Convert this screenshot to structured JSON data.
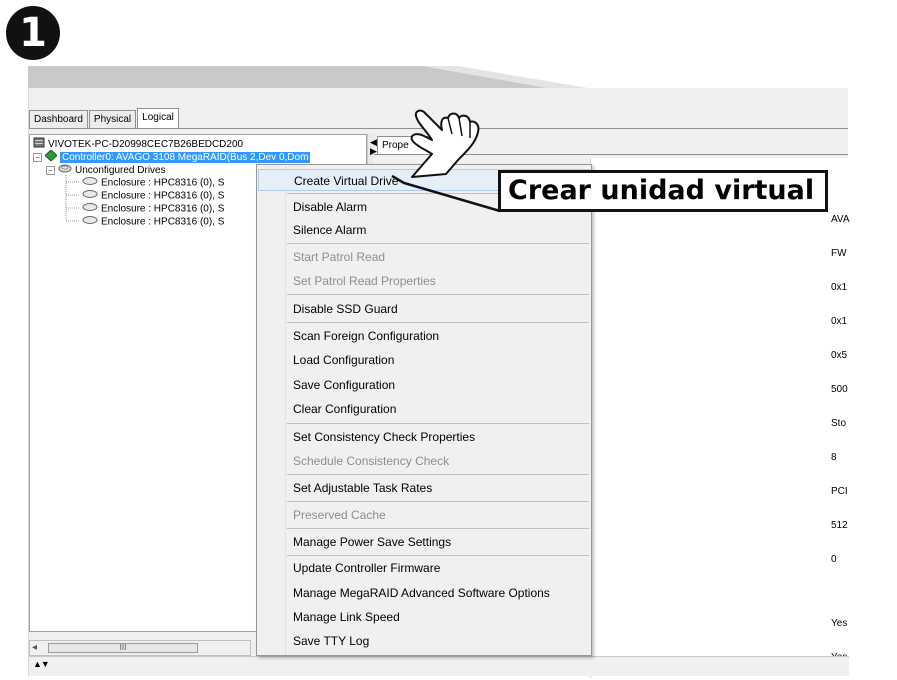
{
  "step": {
    "number": "1"
  },
  "tabs": [
    {
      "label": "Dashboard",
      "active": false
    },
    {
      "label": "Physical",
      "active": false
    },
    {
      "label": "Logical",
      "active": true
    }
  ],
  "tree": {
    "root": "VIVOTEK-PC-D20998CEC7B26BEDCD200",
    "controller": "Controller0: AVAGO 3108 MegaRAID(Bus 2,Dev 0,Dom",
    "unconfigured": "Unconfigured Drives",
    "enclosures": [
      "Enclosure : HPC8316 (0), S",
      "Enclosure : HPC8316 (0), S",
      "Enclosure : HPC8316 (0), S",
      "Enclosure : HPC8316 (0), S"
    ],
    "scroll_thumb": "III",
    "scroll_left": "◂"
  },
  "properties": {
    "tab_label": "Prope",
    "values": [
      "AVA",
      "FW",
      "0x1",
      "0x1",
      "0x5",
      "500",
      "Sto",
      "8",
      "PCI",
      "512",
      "0",
      "Yes",
      "Yes"
    ]
  },
  "menu": {
    "items": [
      {
        "label": "Create Virtual Drive",
        "disabled": false,
        "selected": true
      },
      {
        "label": "Disable Alarm",
        "disabled": false
      },
      {
        "label": "Silence Alarm",
        "disabled": false
      },
      {
        "label": "Start Patrol Read",
        "disabled": true
      },
      {
        "label": "Set Patrol Read Properties",
        "disabled": true
      },
      {
        "label": "Disable SSD Guard",
        "disabled": false
      },
      {
        "label": "Scan Foreign Configuration",
        "disabled": false
      },
      {
        "label": "Load Configuration",
        "disabled": false
      },
      {
        "label": "Save Configuration",
        "disabled": false
      },
      {
        "label": "Clear Configuration",
        "disabled": false
      },
      {
        "label": "Set Consistency Check Properties",
        "disabled": false
      },
      {
        "label": "Schedule Consistency Check",
        "disabled": true
      },
      {
        "label": "Set Adjustable Task Rates",
        "disabled": false
      },
      {
        "label": "Preserved Cache",
        "disabled": true
      },
      {
        "label": "Manage Power Save Settings",
        "disabled": false
      },
      {
        "label": "Update Controller Firmware",
        "disabled": false
      },
      {
        "label": "Manage MegaRAID Advanced Software Options",
        "disabled": false
      },
      {
        "label": "Manage Link Speed",
        "disabled": false
      },
      {
        "label": "Save TTY Log",
        "disabled": false
      }
    ]
  },
  "callout": {
    "text": "Crear unidad virtual"
  },
  "statusbar": {
    "arrows": "▲▼"
  },
  "colors": {
    "selection": "#3399ff",
    "menu_bg": "#f0f0f0",
    "disabled_text": "#8d8d8d",
    "callout_border": "#111111"
  }
}
